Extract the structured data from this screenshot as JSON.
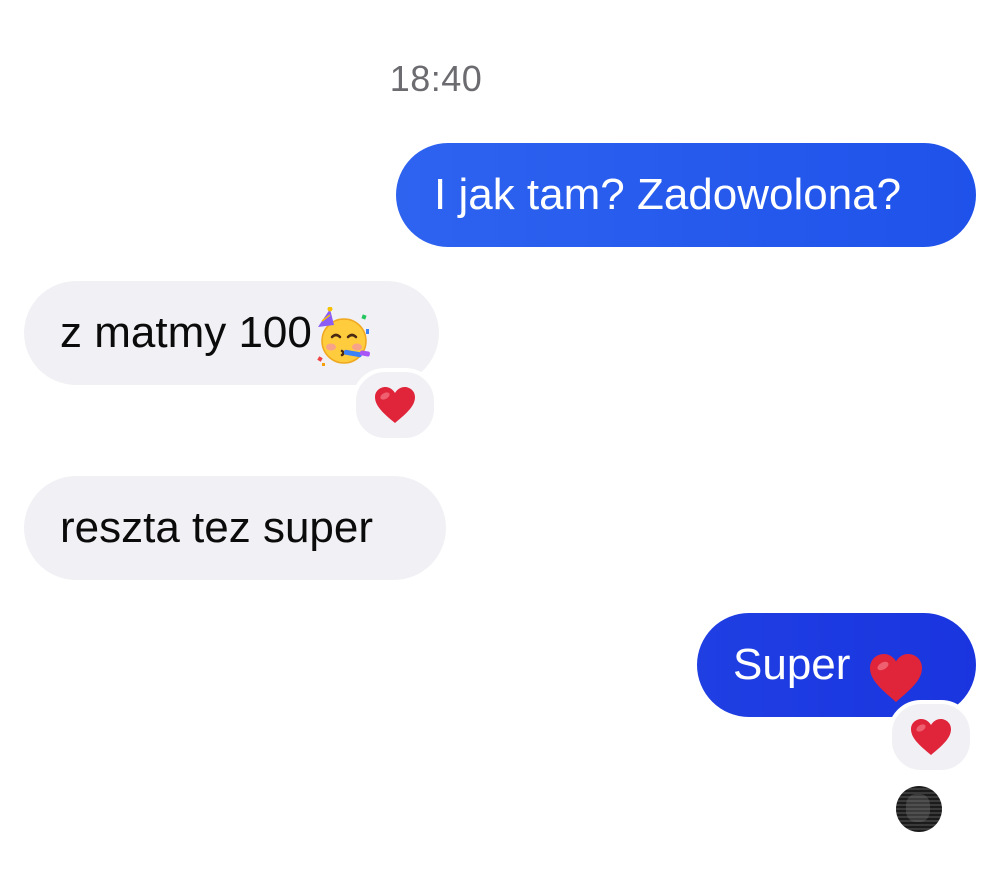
{
  "conversation": {
    "timestamp": "18:40",
    "messages": [
      {
        "direction": "outgoing",
        "text": "I jak tam? Zadowolona?"
      },
      {
        "direction": "incoming",
        "text": "z matmy 100",
        "emoji": "partying-face",
        "reaction": "red-heart"
      },
      {
        "direction": "incoming",
        "text": "reszta tez super"
      },
      {
        "direction": "outgoing",
        "text": "Super",
        "emoji": "red-heart",
        "reaction": "red-heart"
      }
    ]
  },
  "colors": {
    "outgoing_bubble": "#2757ee",
    "incoming_bubble": "#f1f1f5",
    "timestamp_text": "#6b6b70",
    "heart": "#e0243a"
  }
}
